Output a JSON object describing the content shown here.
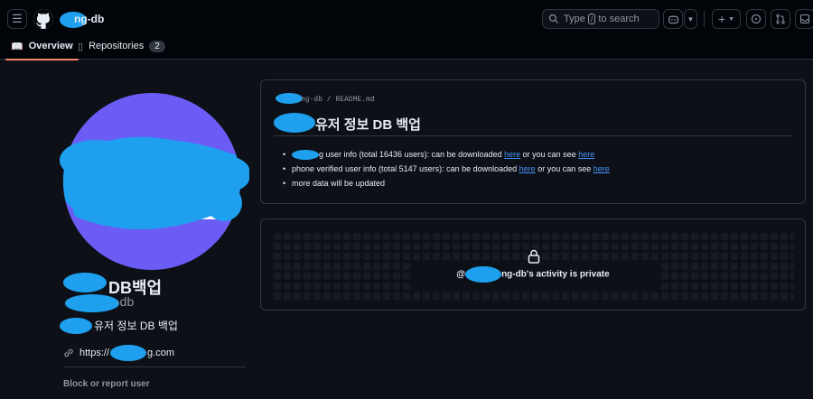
{
  "header": {
    "menu_icon": "hamburger-icon",
    "logo_icon": "github-logo-icon",
    "owner_name": "ng-db",
    "search": {
      "prefix": "Type",
      "key": "/",
      "suffix": "to search"
    },
    "copilot_icon": "copilot-icon",
    "create_icon": "plus-icon",
    "issues_icon": "issue-opened-icon",
    "pulls_icon": "git-pull-request-icon",
    "inbox_icon": "inbox-icon"
  },
  "tabs": [
    {
      "label": "Overview",
      "icon": "book-icon",
      "active": true
    },
    {
      "label": "Repositories",
      "icon": "repo-icon",
      "count": "2"
    }
  ],
  "profile": {
    "display_name": "DB백업",
    "login": "-db",
    "bio": "유저 정보 DB 백업",
    "website": "https://",
    "website_suffix": "g.com",
    "block_report": "Block or report user",
    "avatar_color": "#6b5cf6"
  },
  "readme": {
    "path": "ng-db / README.md",
    "title": "유저 정보 DB 백업",
    "items": [
      {
        "text": "g user info (total 16436 users): can be downloaded ",
        "link1": "here",
        "middle": " or you can see ",
        "link2": "here"
      },
      {
        "text": "phone verified user info (total 5147 users): can be downloaded ",
        "link1": "here",
        "middle": " or you can see ",
        "link2": "here"
      },
      {
        "text": "more data will be updated"
      }
    ]
  },
  "activity": {
    "lock_icon": "lock-icon",
    "prefix": "@",
    "message": "ng-db's activity is private"
  },
  "colors": {
    "background": "#0d1117",
    "header_bg": "#010409",
    "border": "#30363d",
    "link": "#4493f8",
    "tab_underline": "#f78166",
    "redaction": "#1ea0ef"
  }
}
